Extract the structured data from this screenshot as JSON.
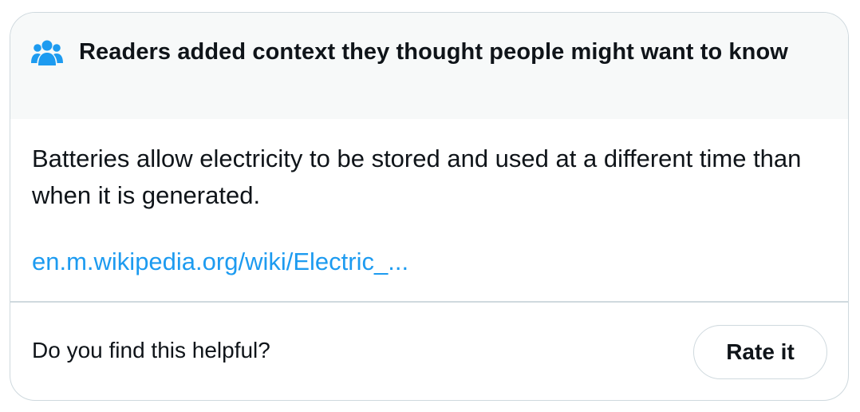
{
  "header": {
    "icon": "people-group-icon",
    "title": "Readers added context they thought people might want to know"
  },
  "note": {
    "text": "Batteries allow electricity to be stored and used at a different time than when it is generated.",
    "link_text": "en.m.wikipedia.org/wiki/Electric_..."
  },
  "footer": {
    "question": "Do you find this helpful?",
    "rate_button_label": "Rate it"
  },
  "colors": {
    "accent": "#1d9bf0",
    "header_bg": "#f7f9f9",
    "border": "#cfd9de",
    "text": "#0f1419"
  }
}
